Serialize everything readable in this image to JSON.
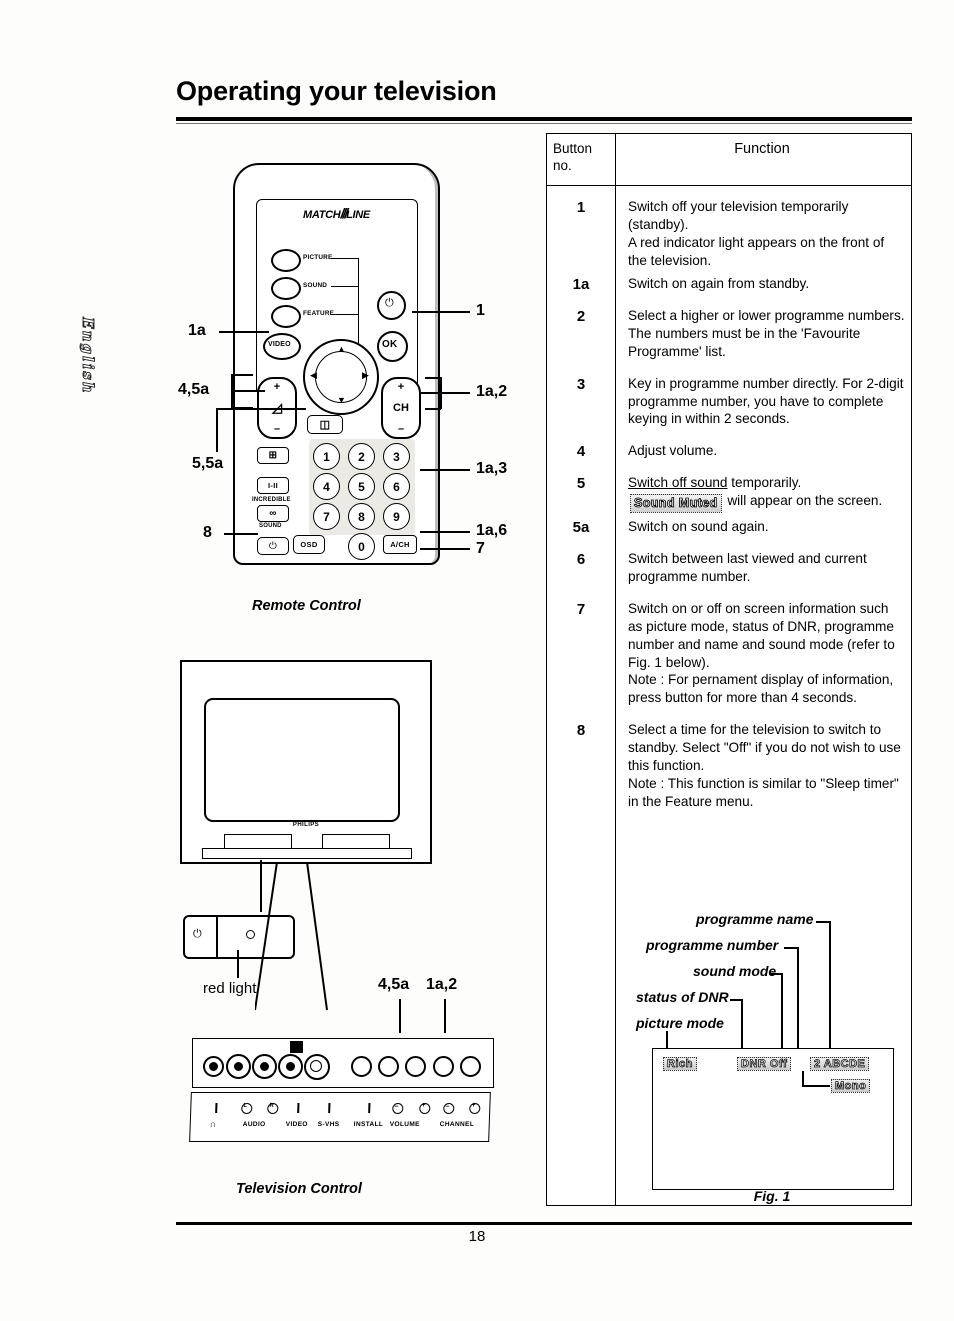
{
  "document": {
    "title": "Operating your television",
    "page_number": "18",
    "side_tab": "English"
  },
  "table": {
    "header": {
      "button_col": "Button\nno.",
      "button_col_line1": "Button",
      "button_col_line2": "no.",
      "function_col": "Function"
    },
    "rows": [
      {
        "no": "1",
        "text": "Switch off your television temporarily (standby).\nA red indicator light appears on the front of the television."
      },
      {
        "no": "1a",
        "text": "Switch on again from standby."
      },
      {
        "no": "2",
        "text": "Select a higher or lower programme numbers. The numbers must be in the 'Favourite Programme' list."
      },
      {
        "no": "3",
        "text": "Key in programme number directly. For 2-digit programme number, you have to complete keying in within 2 seconds."
      },
      {
        "no": "4",
        "text": "Adjust volume."
      },
      {
        "no": "5",
        "text": "Switch off sound temporarily.",
        "underline_part": "Switch off sound",
        "rest": " temporarily.",
        "osd": "Sound Muted",
        "after_osd": "will appear on the screen."
      },
      {
        "no": "5a",
        "text": "Switch on sound again."
      },
      {
        "no": "6",
        "text": "Switch between last viewed and current programme number."
      },
      {
        "no": "7",
        "text": "Switch on or off on screen information such as picture mode, status of DNR, programme number and name and sound mode (refer to Fig. 1 below).\nNote : For pernament display of information, press button for more than 4 seconds."
      },
      {
        "no": "8",
        "text": "Select a time for the television to switch to standby.  Select \"Off\" if you  do not wish to use this function.\nNote : This function is similar to \"Sleep timer\" in the Feature menu."
      }
    ]
  },
  "figure1": {
    "caption": "Fig. 1",
    "callouts": [
      {
        "label": "programme name"
      },
      {
        "label": "programme number"
      },
      {
        "label": "sound mode"
      },
      {
        "label": "status of DNR"
      },
      {
        "label": "picture mode"
      }
    ],
    "osd_items": [
      {
        "name": "picture-mode",
        "text": "Rich"
      },
      {
        "name": "dnr-status",
        "text": "DNR Off"
      },
      {
        "name": "programme-number-name",
        "text": "2 ABCDE"
      },
      {
        "name": "sound-mode",
        "text": "Mono"
      }
    ]
  },
  "remote": {
    "caption": "Remote Control",
    "logo_prefix": "MATCH",
    "logo_bars": "///",
    "logo_suffix": "LINE",
    "mode_buttons": [
      "PICTURE",
      "SOUND",
      "FEATURE"
    ],
    "video_button": "VIDEO",
    "ok_button": "OK",
    "volume_plus": "+",
    "volume_minus": "–",
    "volume_glyph": "◿",
    "ch_label": "CH",
    "ch_plus": "+",
    "ch_minus": "–",
    "mute_glyph": "◫",
    "power_glyph": "⏻",
    "format_glyph": "⊞",
    "sound_ii_label": "I-II",
    "incredible_label": "INCREDIBLE",
    "incredible_glyph": "∞",
    "sound_label": "SOUND",
    "sleep_glyph": "⏻",
    "osd_button": "OSD",
    "ach_button": "A/CH",
    "keypad": [
      "1",
      "2",
      "3",
      "4",
      "5",
      "6",
      "7",
      "8",
      "9",
      "0"
    ],
    "callouts_left": [
      "1a",
      "4,5a",
      "5,5a",
      "8"
    ],
    "callouts_right": [
      "1",
      "1a,2",
      "1a,3",
      "1a,6",
      "7"
    ]
  },
  "television": {
    "caption": "Television Control",
    "brand": "PHILIPS",
    "red_light_label": "red light",
    "panel_callouts": [
      "4,5a",
      "1a,2"
    ],
    "jack_labels": [
      "AUDIO",
      "VIDEO",
      "S-VHS",
      "INSTALL",
      "VOLUME",
      "CHANNEL"
    ],
    "headphone_glyph": "∩",
    "audio_l": "L",
    "audio_r": "R",
    "volume_minus": "–",
    "volume_plus": "+",
    "channel_minus": "–",
    "channel_plus": "+"
  }
}
